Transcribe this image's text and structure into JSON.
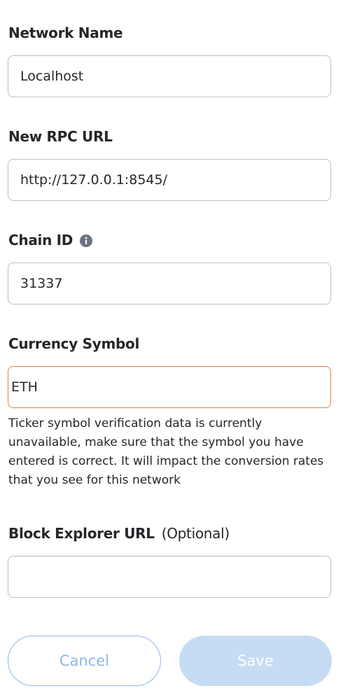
{
  "form": {
    "network_name": {
      "label": "Network Name",
      "value": "Localhost"
    },
    "rpc_url": {
      "label": "New RPC URL",
      "value": "http://127.0.0.1:8545/"
    },
    "chain_id": {
      "label": "Chain ID",
      "value": "31337",
      "info_icon": "info-icon"
    },
    "currency_symbol": {
      "label": "Currency Symbol",
      "value": "ETH",
      "warning": "Ticker symbol verification data is currently unavailable, make sure that the symbol you have entered is correct. It will impact the conversion rates that you see for this network"
    },
    "block_explorer": {
      "label": "Block Explorer URL",
      "optional_label": "(Optional)",
      "value": ""
    }
  },
  "buttons": {
    "cancel_label": "Cancel",
    "save_label": "Save"
  },
  "colors": {
    "text": "#24272a",
    "border": "#bbc0c5",
    "warning_border": "#e2823c",
    "primary_light": "#8fb5e9",
    "primary_disabled": "#c6dcf4"
  }
}
